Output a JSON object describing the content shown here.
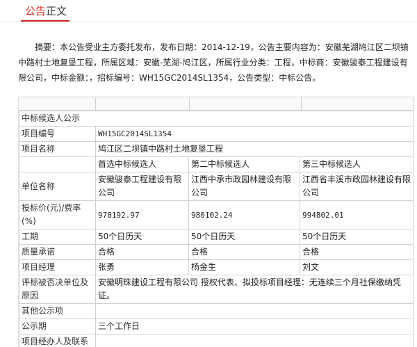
{
  "tab": {
    "part1": "公告",
    "part2": "正文"
  },
  "summary": "摘要：本公告受业主方委托发布，发布日期：2014-12-19，公告主要内容为：安徽芜湖鸠江区二坝镇中路村土地复垦工程，所属区域：安徽-芜湖-鸠江区，所属行业分类：工程，中标商：安徽骏泰工程建设有限公司，中标金额：，招标编号：WH15GC2014SL1354，公告类型：中标公告。",
  "table": {
    "section_title": "中标候选人公示",
    "project_no_label": "项目编号",
    "project_no": "WH15GC2014SL1354",
    "project_name_label": "项目名称",
    "project_name": "鸠江区二坝镇中路村土地复垦工程",
    "candidates_header": [
      "首选中标候选人",
      "第二中标候选人",
      "第三中标候选人"
    ],
    "company_label": "单位名称",
    "companies": [
      "安徽骏泰工程建设有限公司",
      "江西中承市政园林建设有限公司",
      "江西省丰溪市政园林建设有限公司"
    ],
    "price_label": "投标价(元)/费率(%)",
    "prices": [
      "978192.97",
      "980102.24",
      "994802.01"
    ],
    "period_label": "工期",
    "periods": [
      "50个日历天",
      "50个日历天",
      "50个日历天"
    ],
    "quality_label": "质量承诺",
    "qualities": [
      "合格",
      "合格",
      "合格"
    ],
    "manager_label": "项目经理",
    "managers": [
      "张勇",
      "杨金生",
      "刘文"
    ],
    "rejected_label": "评标被否决单位及原因",
    "rejected": "安徽明珠建设工程有限公司  授权代表、拟投标项目经理：无连续三个月社保缴纳凭证。",
    "other_label": "其他公示项",
    "other": "",
    "period_pub_label": "公示期",
    "period_pub": "三个工作日",
    "contact_label": "项目经办人及联系"
  }
}
